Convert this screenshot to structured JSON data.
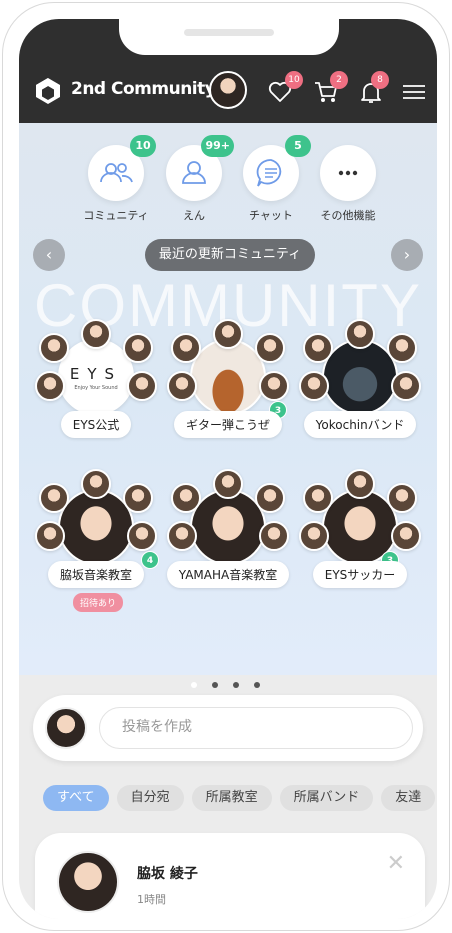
{
  "header": {
    "brand": "2nd Community",
    "likes_count": "10",
    "cart_count": "2",
    "notifications_count": "8"
  },
  "quick_actions": [
    {
      "label": "コミュニティ",
      "badge": "10",
      "icon": "people-icon"
    },
    {
      "label": "えん",
      "badge": "99+",
      "icon": "person-icon"
    },
    {
      "label": "チャット",
      "badge": "5",
      "icon": "chat-icon"
    },
    {
      "label": "その他機能",
      "badge": "",
      "icon": "more-icon"
    }
  ],
  "carousel": {
    "title": "最近の更新コミュニティ",
    "watermark": "COMMUNITY",
    "communities": [
      {
        "name": "EYS公式",
        "badge": "",
        "logo_text": "EYS",
        "logo_sub": "Enjoy Your Sound"
      },
      {
        "name": "ギター弾こうぜ",
        "badge": "3"
      },
      {
        "name": "Yokochinバンド",
        "badge": ""
      },
      {
        "name": "脇坂音楽教室",
        "badge": "4",
        "tag": "招待あり"
      },
      {
        "name": "YAMAHA音楽教室",
        "badge": ""
      },
      {
        "name": "EYSサッカー",
        "badge": "3"
      }
    ],
    "page_count": 4,
    "active_page": 0
  },
  "composer": {
    "placeholder": "投稿を作成"
  },
  "filters": [
    "すべて",
    "自分宛",
    "所属教室",
    "所属バンド",
    "友達"
  ],
  "post": {
    "author": "脇坂 綾子",
    "time": "1時間"
  },
  "colors": {
    "header_bg": "#2f2f2f",
    "badge_green": "#3dc38c",
    "badge_red": "#ef6f82",
    "chip_active": "#8eb8f2"
  }
}
